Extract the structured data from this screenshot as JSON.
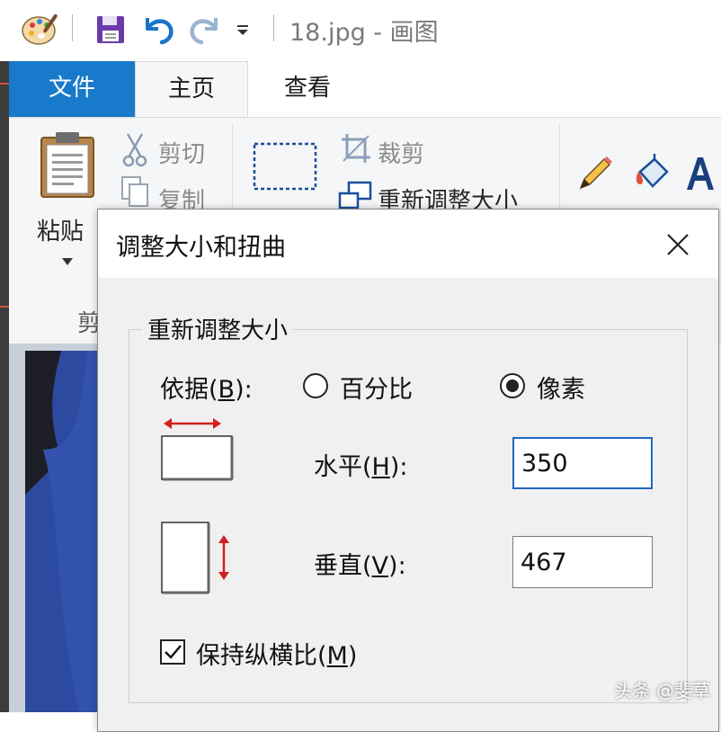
{
  "window": {
    "title": "18.jpg - 画图"
  },
  "tabs": {
    "file": "文件",
    "home": "主页",
    "view": "查看"
  },
  "ribbon": {
    "paste": "粘贴",
    "cut": "剪切",
    "copy": "复制",
    "crop": "裁剪",
    "resize": "重新调整大小",
    "clipboard_group_fragment": "剪"
  },
  "dialog": {
    "title": "调整大小和扭曲",
    "resize_group": "重新调整大小",
    "by_label": "依据(",
    "by_hotkey": "B",
    "by_suffix": "):",
    "option_percent": "百分比",
    "option_pixels": "像素",
    "selected_option": "像素",
    "horizontal_label": "水平(",
    "horizontal_hotkey": "H",
    "horizontal_suffix": "):",
    "horizontal_value": "350",
    "vertical_label": "垂直(",
    "vertical_hotkey": "V",
    "vertical_suffix": "):",
    "vertical_value": "467",
    "aspect_label": "保持纵横比(",
    "aspect_hotkey": "M",
    "aspect_suffix": ")",
    "aspect_checked": true
  },
  "watermark": "头条 @斐草",
  "colors": {
    "file_tab": "#1979ca",
    "focus_border": "#1f66c4",
    "arrow_red": "#d32020"
  }
}
